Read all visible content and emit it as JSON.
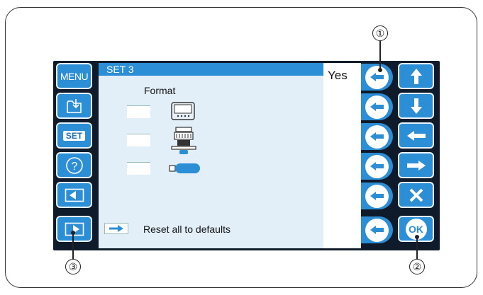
{
  "left_buttons": [
    {
      "label": "MENU",
      "icon": "menu"
    },
    {
      "label": "",
      "icon": "folder-save-icon"
    },
    {
      "label": "SET",
      "icon": "set"
    },
    {
      "label": "",
      "icon": "help-icon"
    },
    {
      "label": "",
      "icon": "page-back-icon"
    },
    {
      "label": "",
      "icon": "page-forward-icon"
    }
  ],
  "screen": {
    "title": "SET 3",
    "yes_label": "Yes",
    "format_label": "Format",
    "format_items": [
      "screen-device-icon",
      "embroidery-machine-icon",
      "usb-stick-icon"
    ],
    "reset_label": "Reset all to defaults"
  },
  "right_buttons": [
    "up-arrow-icon",
    "down-arrow-icon",
    "left-arrow-icon",
    "right-arrow-icon",
    "close-icon",
    "ok-icon"
  ],
  "ok_label": "OK",
  "callouts": [
    "①",
    "②",
    "③"
  ],
  "colors": {
    "accent": "#2c8fd6",
    "screen_bg": "#e2eff8",
    "panel": "#0f1a2b"
  }
}
